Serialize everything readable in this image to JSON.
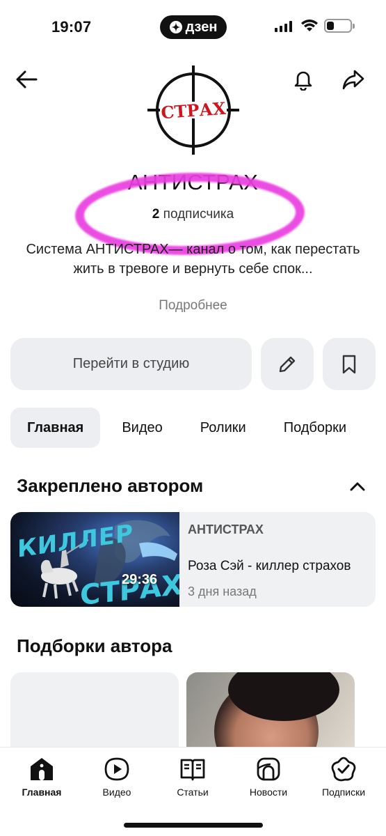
{
  "status_bar": {
    "time": "19:07",
    "app_badge": "дзен",
    "battery_level": 0.3
  },
  "channel": {
    "logo_text": "СТРАХ",
    "name": "АНТИСТРАХ",
    "subscribers_count": "2",
    "subscribers_label": "подписчика",
    "description": "Система АНТИСТРАХ— канал о том, как перестать жить в тревоге и вернуть себе спок...",
    "more_label": "Подробнее"
  },
  "actions": {
    "studio_label": "Перейти в студию",
    "edit_icon": "pencil-icon",
    "save_icon": "bookmark-icon"
  },
  "tabs": [
    {
      "label": "Главная",
      "active": true
    },
    {
      "label": "Видео",
      "active": false
    },
    {
      "label": "Ролики",
      "active": false
    },
    {
      "label": "Подборки",
      "active": false
    }
  ],
  "pinned": {
    "title": "Закреплено автором",
    "video": {
      "thumb_word1": "КИЛЛЕР",
      "thumb_word2": "СТРАХОВ",
      "duration": "29:36",
      "channel": "АНТИСТРАХ",
      "title": "Роза Сэй - киллер страхов",
      "date": "3 дня назад"
    }
  },
  "collections": {
    "title": "Подборки автора"
  },
  "bottom_nav": [
    {
      "label": "Главная",
      "icon": "home-icon",
      "active": true
    },
    {
      "label": "Видео",
      "icon": "video-icon",
      "active": false
    },
    {
      "label": "Статьи",
      "icon": "articles-icon",
      "active": false
    },
    {
      "label": "Новости",
      "icon": "news-icon",
      "active": false
    },
    {
      "label": "Подписки",
      "icon": "subscriptions-icon",
      "active": false
    }
  ],
  "colors": {
    "highlight_ring": "#ea3ee0",
    "logo_red": "#d0141c",
    "button_bg": "#eceef1"
  }
}
